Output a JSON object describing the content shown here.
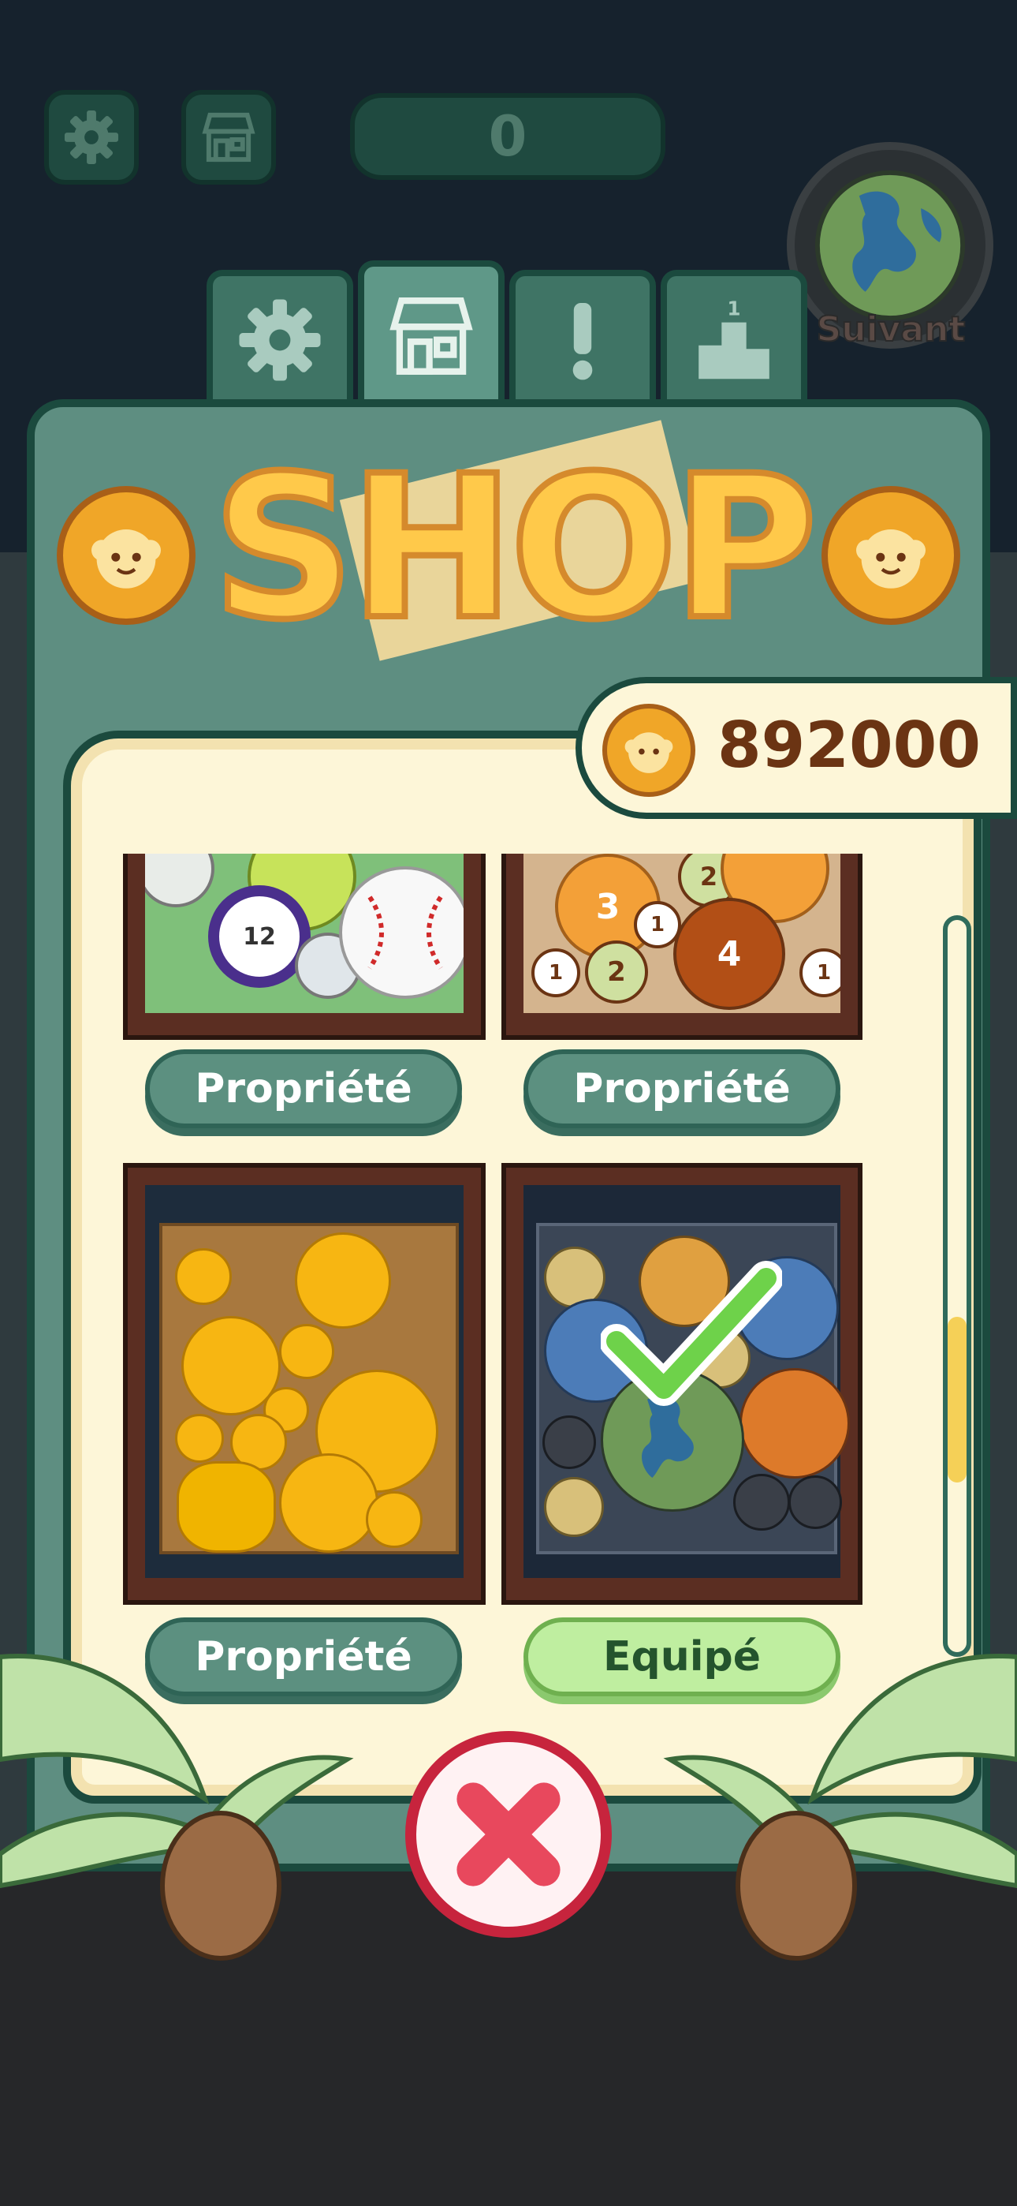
{
  "hud": {
    "score": "0",
    "next_label": "Suivant",
    "settings_icon": "gear-icon",
    "shop_icon": "shop-icon"
  },
  "tabs": [
    {
      "name": "settings",
      "icon": "gear-icon",
      "active": false
    },
    {
      "name": "shop",
      "icon": "shop-icon",
      "active": true
    },
    {
      "name": "alerts",
      "icon": "exclamation-icon",
      "active": false
    },
    {
      "name": "ranking",
      "icon": "podium-icon",
      "active": false
    }
  ],
  "shop": {
    "title": "SHOP",
    "balance": "892000",
    "scroll_position": 0.7,
    "items": [
      {
        "theme": "sports-balls",
        "button_label": "Propriété",
        "status": "owned"
      },
      {
        "theme": "numbered-circles",
        "button_label": "Propriété",
        "status": "owned",
        "numbers": [
          "3",
          "2",
          "4",
          "1",
          "2",
          "1"
        ]
      },
      {
        "theme": "golden-fruits",
        "button_label": "Propriété",
        "status": "owned"
      },
      {
        "theme": "planets",
        "button_label": "Equipé",
        "status": "equipped"
      }
    ],
    "billiard_number": "12"
  },
  "colors": {
    "panel": "#5e8e81",
    "panel_border": "#1b4a3e",
    "inner": "#fdf6d8",
    "coin": "#f0a628",
    "balance_text": "#6b3413",
    "owned_button": "#5c9080",
    "equipped_button": "#bfeea0",
    "close": "#c7243d"
  }
}
